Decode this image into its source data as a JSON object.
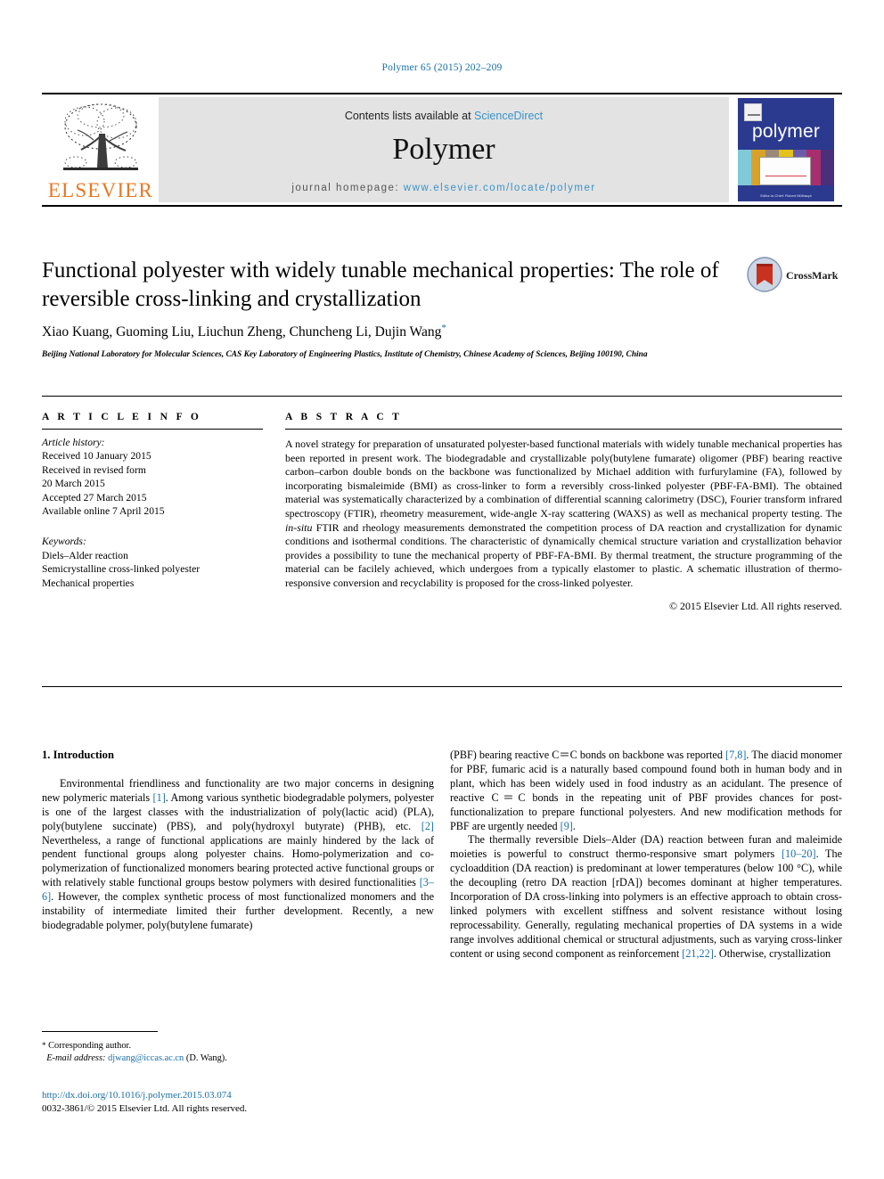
{
  "running_head": "Polymer 65 (2015) 202–209",
  "masthead": {
    "contents_prefix": "Contents lists available at",
    "sciencedirect": "ScienceDirect",
    "journal_name": "Polymer",
    "homepage_prefix": "journal homepage:",
    "homepage_url": "www.elsevier.com/locate/polymer",
    "publisher_wordmark": "ELSEVIER",
    "cover_title": "polymer",
    "cover_footer": "Editor-in-Chief: Robert Mülhaupt"
  },
  "article": {
    "title": "Functional polyester with widely tunable mechanical properties: The role of reversible cross-linking and crystallization",
    "authors": "Xiao Kuang, Guoming Liu, Liuchun Zheng, Chuncheng Li, Dujin Wang",
    "author_star": "*",
    "affiliation": "Beijing National Laboratory for Molecular Sciences, CAS Key Laboratory of Engineering Plastics, Institute of Chemistry, Chinese Academy of Sciences, Beijing 100190, China"
  },
  "crossmark": {
    "label": "CrossMark"
  },
  "info": {
    "heading": "A R T I C L E   I N F O",
    "history_label": "Article history:",
    "history": [
      "Received 10 January 2015",
      "Received in revised form",
      "20 March 2015",
      "Accepted 27 March 2015",
      "Available online 7 April 2015"
    ],
    "keywords_label": "Keywords:",
    "keywords": [
      "Diels–Alder reaction",
      "Semicrystalline cross-linked polyester",
      "Mechanical properties"
    ]
  },
  "abstract": {
    "heading": "A B S T R A C T",
    "text": "A novel strategy for preparation of unsaturated polyester-based functional materials with widely tunable mechanical properties has been reported in present work. The biodegradable and crystallizable poly(butylene fumarate) oligomer (PBF) bearing reactive carbon–carbon double bonds on the backbone was functionalized by Michael addition with furfurylamine (FA), followed by incorporating bismaleimide (BMI) as cross-linker to form a reversibly cross-linked polyester (PBF-FA-BMI). The obtained material was systematically characterized by a combination of differential scanning calorimetry (DSC), Fourier transform infrared spectroscopy (FTIR), rheometry measurement, wide-angle X-ray scattering (WAXS) as well as mechanical property testing. The in-situ FTIR and rheology measurements demonstrated the competition process of DA reaction and crystallization for dynamic conditions and isothermal conditions. The characteristic of dynamically chemical structure variation and crystallization behavior provides a possibility to tune the mechanical property of PBF-FA-BMI. By thermal treatment, the structure programming of the material can be facilely achieved, which undergoes from a typically elastomer to plastic. A schematic illustration of thermo-responsive conversion and recyclability is proposed for the cross-linked polyester.",
    "copyright": "© 2015 Elsevier Ltd. All rights reserved."
  },
  "body": {
    "section_title": "1. Introduction",
    "left_paragraphs": [
      "Environmental friendliness and functionality are two major concerns in designing new polymeric materials [1]. Among various synthetic biodegradable polymers, polyester is one of the largest classes with the industrialization of poly(lactic acid) (PLA), poly(butylene succinate) (PBS), and poly(hydroxyl butyrate) (PHB), etc. [2] Nevertheless, a range of functional applications are mainly hindered by the lack of pendent functional groups along polyester chains. Homo-polymerization and co-polymerization of functionalized monomers bearing protected active functional groups or with relatively stable functional groups bestow polymers with desired functionalities [3–6]. However, the complex synthetic process of most functionalized monomers and the instability of intermediate limited their further development. Recently, a new biodegradable polymer, poly(butylene fumarate)"
    ],
    "right_paragraphs": [
      "(PBF) bearing reactive C＝C bonds on backbone was reported [7,8]. The diacid monomer for PBF, fumaric acid is a naturally based compound found both in human body and in plant, which has been widely used in food industry as an acidulant. The presence of reactive C＝C bonds in the repeating unit of PBF provides chances for post-functionalization to prepare functional polyesters. And new modification methods for PBF are urgently needed [9].",
      "The thermally reversible Diels–Alder (DA) reaction between furan and maleimide moieties is powerful to construct thermo-responsive smart polymers [10–20]. The cycloaddition (DA reaction) is predominant at lower temperatures (below 100 °C), while the decoupling (retro DA reaction [rDA]) becomes dominant at higher temperatures. Incorporation of DA cross-linking into polymers is an effective approach to obtain cross-linked polymers with excellent stiffness and solvent resistance without losing reprocessability. Generally, regulating mechanical properties of DA systems in a wide range involves additional chemical or structural adjustments, such as varying cross-linker content or using second component as reinforcement [21,22]. Otherwise, crystallization"
    ]
  },
  "footer": {
    "corresponding_star": "*",
    "corresponding_label": "Corresponding author.",
    "email_label": "E-mail address:",
    "email": "djwang@iccas.ac.cn",
    "email_suffix": "(D. Wang).",
    "doi": "http://dx.doi.org/10.1016/j.polymer.2015.03.074",
    "issn_line": "0032-3861/© 2015 Elsevier Ltd. All rights reserved."
  },
  "colors": {
    "link_blue": "#1a6ea8",
    "sciencedirect_blue": "#3a93c8",
    "elsevier_orange": "#E87722",
    "cover_blue": "#2b3a8f"
  }
}
